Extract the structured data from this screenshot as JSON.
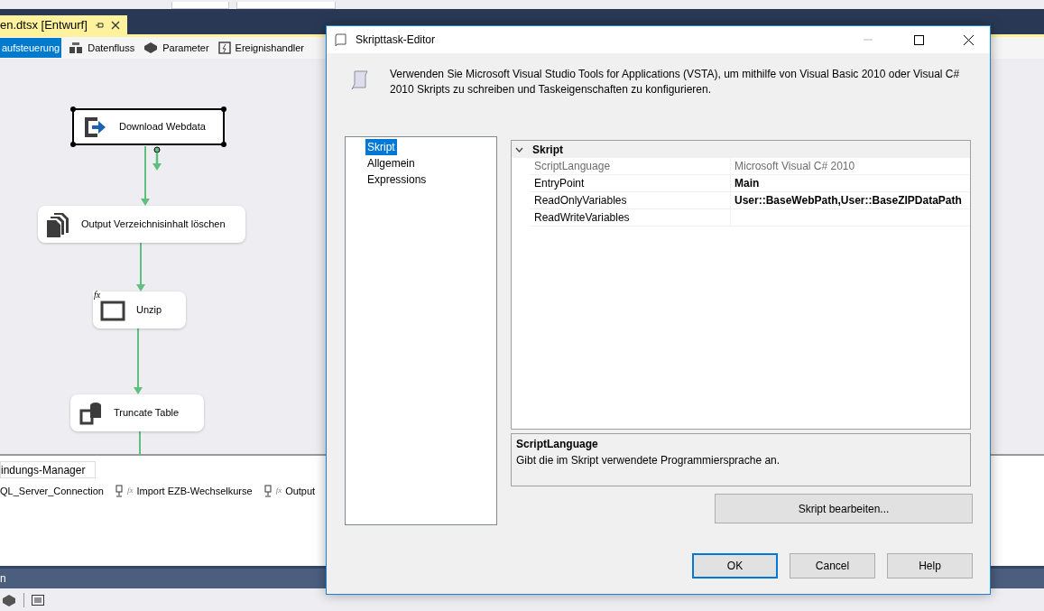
{
  "document_tab": {
    "title": "en.dtsx [Entwurf]"
  },
  "designer_tabs": [
    {
      "label": "aufsteuerung",
      "selected": true,
      "kind": "control"
    },
    {
      "label": "Datenfluss",
      "selected": false,
      "kind": "dataflow"
    },
    {
      "label": "Parameter",
      "selected": false,
      "kind": "parameter"
    },
    {
      "label": "Ereignishandler",
      "selected": false,
      "kind": "event"
    }
  ],
  "flow_tasks": [
    {
      "label": "Download Webdata",
      "selected": true,
      "kind": "download"
    },
    {
      "label": "Output Verzeichnisinhalt löschen",
      "selected": false,
      "kind": "files"
    },
    {
      "label": "Unzip",
      "selected": false,
      "kind": "process",
      "badge": "fx"
    },
    {
      "label": "Truncate Table",
      "selected": false,
      "kind": "sql"
    }
  ],
  "connection_managers": {
    "tab": "indungs-Manager",
    "items": [
      {
        "label": "QL_Server_Connection",
        "kind": "plain"
      },
      {
        "label": "Import EZB-Wechselkurse",
        "kind": "file",
        "badge": "fx"
      },
      {
        "label": "Output",
        "kind": "file",
        "badge": "fx"
      }
    ]
  },
  "bottom_panel": {
    "title": "n"
  },
  "dialog": {
    "title": "Skripttask-Editor",
    "description": "Verwenden Sie Microsoft Visual Studio Tools for Applications (VSTA), um mithilfe von Visual Basic 2010 oder Visual C# 2010 Skripts zu schreiben und Taskeigenschaften zu konfigurieren.",
    "pages": [
      {
        "label": "Skript",
        "selected": true
      },
      {
        "label": "Allgemein",
        "selected": false
      },
      {
        "label": "Expressions",
        "selected": false
      }
    ],
    "property_grid": {
      "category": "Skript",
      "expanded": true,
      "rows": [
        {
          "name": "ScriptLanguage",
          "value": "Microsoft Visual C# 2010",
          "disabled": true
        },
        {
          "name": "EntryPoint",
          "value": "Main",
          "disabled": false,
          "modified": true
        },
        {
          "name": "ReadOnlyVariables",
          "value": "User::BaseWebPath,User::BaseZIPDataPath",
          "disabled": false,
          "modified": true
        },
        {
          "name": "ReadWriteVariables",
          "disabled": false
        }
      ]
    },
    "help": {
      "title": "ScriptLanguage",
      "text": "Gibt die im Skript verwendete Programmiersprache an."
    },
    "edit_button": "Skript bearbeiten...",
    "buttons": [
      {
        "label": "OK",
        "default": true
      },
      {
        "label": "Cancel",
        "default": false
      },
      {
        "label": "Help",
        "default": false
      }
    ]
  }
}
